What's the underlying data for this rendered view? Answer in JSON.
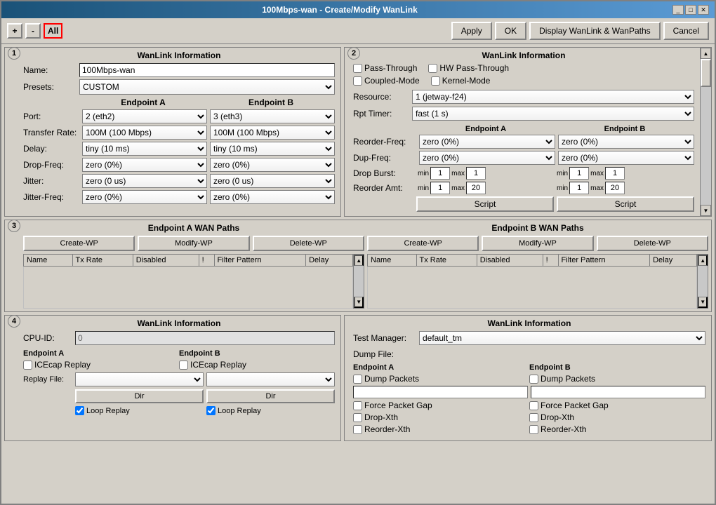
{
  "window": {
    "title": "100Mbps-wan - Create/Modify WanLink"
  },
  "toolbar": {
    "add_label": "+",
    "remove_label": "-",
    "all_label": "All",
    "apply_label": "Apply",
    "ok_label": "OK",
    "display_label": "Display WanLink & WanPaths",
    "cancel_label": "Cancel"
  },
  "section1": {
    "number": "1",
    "title": "WanLink Information",
    "name_label": "Name:",
    "name_value": "100Mbps-wan",
    "presets_label": "Presets:",
    "presets_value": "CUSTOM",
    "endpoint_a_label": "Endpoint A",
    "endpoint_b_label": "Endpoint B",
    "port_label": "Port:",
    "port_a_value": "2 (eth2)",
    "port_b_value": "3 (eth3)",
    "transfer_label": "Transfer Rate:",
    "transfer_a_value": "100M   (100 Mbps)",
    "transfer_b_value": "100M   (100 Mbps)",
    "delay_label": "Delay:",
    "delay_a_value": "tiny  (10 ms)",
    "delay_b_value": "tiny  (10 ms)",
    "drop_label": "Drop-Freq:",
    "drop_a_value": "zero  (0%)",
    "drop_b_value": "zero  (0%)",
    "jitter_label": "Jitter:",
    "jitter_a_value": "zero  (0 us)",
    "jitter_b_value": "zero  (0 us)",
    "jitter_freq_label": "Jitter-Freq:",
    "jitter_freq_a_value": "zero  (0%)",
    "jitter_freq_b_value": "zero  (0%)"
  },
  "section2": {
    "number": "2",
    "title": "WanLink Information",
    "passthrough_label": "Pass-Through",
    "hw_passthrough_label": "HW Pass-Through",
    "coupled_label": "Coupled-Mode",
    "kernel_label": "Kernel-Mode",
    "resource_label": "Resource:",
    "resource_value": "1 (jetway-f24)",
    "rpt_timer_label": "Rpt Timer:",
    "rpt_timer_value": "fast       (1 s)",
    "endpoint_a_label": "Endpoint A",
    "endpoint_b_label": "Endpoint B",
    "reorder_freq_label": "Reorder-Freq:",
    "reorder_freq_a_value": "zero  (0%)",
    "reorder_freq_b_value": "zero  (0%)",
    "dup_freq_label": "Dup-Freq:",
    "dup_freq_a_value": "zero  (0%)",
    "dup_freq_b_value": "zero  (0%)",
    "drop_burst_label": "Drop Burst:",
    "drop_burst_a_min": "1",
    "drop_burst_a_max": "1",
    "drop_burst_b_min": "1",
    "drop_burst_b_max": "1",
    "reorder_amt_label": "Reorder Amt:",
    "reorder_amt_a_min": "1",
    "reorder_amt_a_max": "20",
    "reorder_amt_b_min": "1",
    "reorder_amt_b_max": "20",
    "script_label": "Script",
    "min_label": "min",
    "max_label": "max"
  },
  "section3": {
    "number": "3",
    "ep_a_title": "Endpoint A WAN Paths",
    "ep_b_title": "Endpoint B WAN Paths",
    "create_wp_label": "Create-WP",
    "modify_wp_label": "Modify-WP",
    "delete_wp_label": "Delete-WP",
    "col_name": "Name",
    "col_tx_rate": "Tx Rate",
    "col_disabled": "Disabled",
    "col_excl": "!",
    "col_filter": "Filter Pattern",
    "col_delay": "Delay"
  },
  "section4": {
    "number": "4",
    "left_title": "WanLink Information",
    "right_title": "WanLink Information",
    "cpu_label": "CPU-ID:",
    "cpu_value": "0",
    "ep_a_label": "Endpoint A",
    "ep_b_label": "Endpoint B",
    "icecap_a_label": "ICEcap Replay",
    "icecap_b_label": "ICEcap Replay",
    "replay_file_label": "Replay File:",
    "dir_label": "Dir",
    "loop_replay_label": "Loop Replay",
    "test_manager_label": "Test Manager:",
    "test_manager_value": "default_tm",
    "dump_file_label": "Dump File:",
    "ep_a_right_label": "Endpoint A",
    "ep_b_right_label": "Endpoint B",
    "dump_packets_a_label": "Dump Packets",
    "dump_packets_b_label": "Dump Packets",
    "force_gap_a_label": "Force Packet Gap",
    "force_gap_b_label": "Force Packet Gap",
    "drop_xth_a_label": "Drop-Xth",
    "drop_xth_b_label": "Drop-Xth",
    "reorder_xth_a_label": "Reorder-Xth",
    "reorder_xth_b_label": "Reorder-Xth"
  },
  "icons": {
    "minimize": "_",
    "maximize": "□",
    "close": "✕",
    "scroll_up": "▲",
    "scroll_down": "▼",
    "dropdown": "▼"
  }
}
